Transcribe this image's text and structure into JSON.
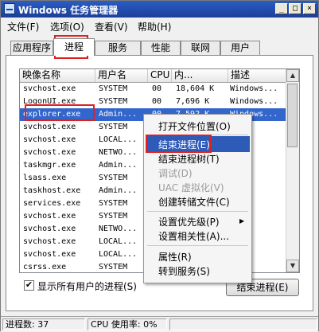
{
  "window": {
    "title": "Windows 任务管理器",
    "minimize": "_",
    "maximize": "□",
    "close": "×"
  },
  "menubar": [
    "文件(F)",
    "选项(O)",
    "查看(V)",
    "帮助(H)"
  ],
  "tabs": [
    "应用程序",
    "进程",
    "服务",
    "性能",
    "联网",
    "用户"
  ],
  "active_tab": "进程",
  "columns": [
    "映像名称",
    "用户名",
    "CPU",
    "内...",
    "描述"
  ],
  "processes": [
    {
      "name": "svchost.exe",
      "user": "SYSTEM",
      "cpu": "00",
      "mem": "18,604 K",
      "desc": "Windows..."
    },
    {
      "name": "LogonUI.exe",
      "user": "SYSTEM",
      "cpu": "00",
      "mem": "7,696 K",
      "desc": "Windows..."
    },
    {
      "name": "explorer.exe",
      "user": "Admin...",
      "cpu": "00",
      "mem": "7,592 K",
      "desc": "Windows..."
    },
    {
      "name": "svchost.exe",
      "user": "SYSTEM",
      "cpu": "",
      "mem": "",
      "desc": ""
    },
    {
      "name": "svchost.exe",
      "user": "LOCAL...",
      "cpu": "",
      "mem": "",
      "desc": ""
    },
    {
      "name": "svchost.exe",
      "user": "NETWO...",
      "cpu": "",
      "mem": "",
      "desc": ""
    },
    {
      "name": "taskmgr.exe",
      "user": "Admin...",
      "cpu": "",
      "mem": "",
      "desc": ""
    },
    {
      "name": "lsass.exe",
      "user": "SYSTEM",
      "cpu": "",
      "mem": "",
      "desc": ""
    },
    {
      "name": "taskhost.exe",
      "user": "Admin...",
      "cpu": "",
      "mem": "",
      "desc": ""
    },
    {
      "name": "services.exe",
      "user": "SYSTEM",
      "cpu": "",
      "mem": "",
      "desc": ""
    },
    {
      "name": "svchost.exe",
      "user": "SYSTEM",
      "cpu": "",
      "mem": "",
      "desc": ""
    },
    {
      "name": "svchost.exe",
      "user": "NETWO...",
      "cpu": "",
      "mem": "",
      "desc": ""
    },
    {
      "name": "svchost.exe",
      "user": "LOCAL...",
      "cpu": "",
      "mem": "",
      "desc": ""
    },
    {
      "name": "svchost.exe",
      "user": "LOCAL...",
      "cpu": "",
      "mem": "",
      "desc": ""
    },
    {
      "name": "csrss.exe",
      "user": "SYSTEM",
      "cpu": "",
      "mem": "",
      "desc": ""
    }
  ],
  "selected_process": "explorer.exe",
  "context_menu": [
    {
      "label": "打开文件位置(O)",
      "enabled": true
    },
    {
      "separator": true
    },
    {
      "label": "结束进程(E)",
      "enabled": true,
      "highlighted": true
    },
    {
      "label": "结束进程树(T)",
      "enabled": true
    },
    {
      "label": "调试(D)",
      "enabled": false
    },
    {
      "label": "UAC 虚拟化(V)",
      "enabled": false
    },
    {
      "label": "创建转储文件(C)",
      "enabled": true
    },
    {
      "separator": true
    },
    {
      "label": "设置优先级(P)",
      "enabled": true,
      "submenu": true
    },
    {
      "label": "设置相关性(A)...",
      "enabled": true
    },
    {
      "separator": true
    },
    {
      "label": "属性(R)",
      "enabled": true
    },
    {
      "label": "转到服务(S)",
      "enabled": true
    }
  ],
  "show_all_users": {
    "label": "显示所有用户的进程(S)",
    "checked": true,
    "mark": "✔"
  },
  "end_process_button": "结束进程(E)",
  "statusbar": {
    "processes": "进程数: 37",
    "cpu": "CPU 使用率: 0%"
  },
  "colors": {
    "selection": "#3366cc",
    "menu_highlight": "#2e5bb8",
    "annotation": "#e02020"
  }
}
